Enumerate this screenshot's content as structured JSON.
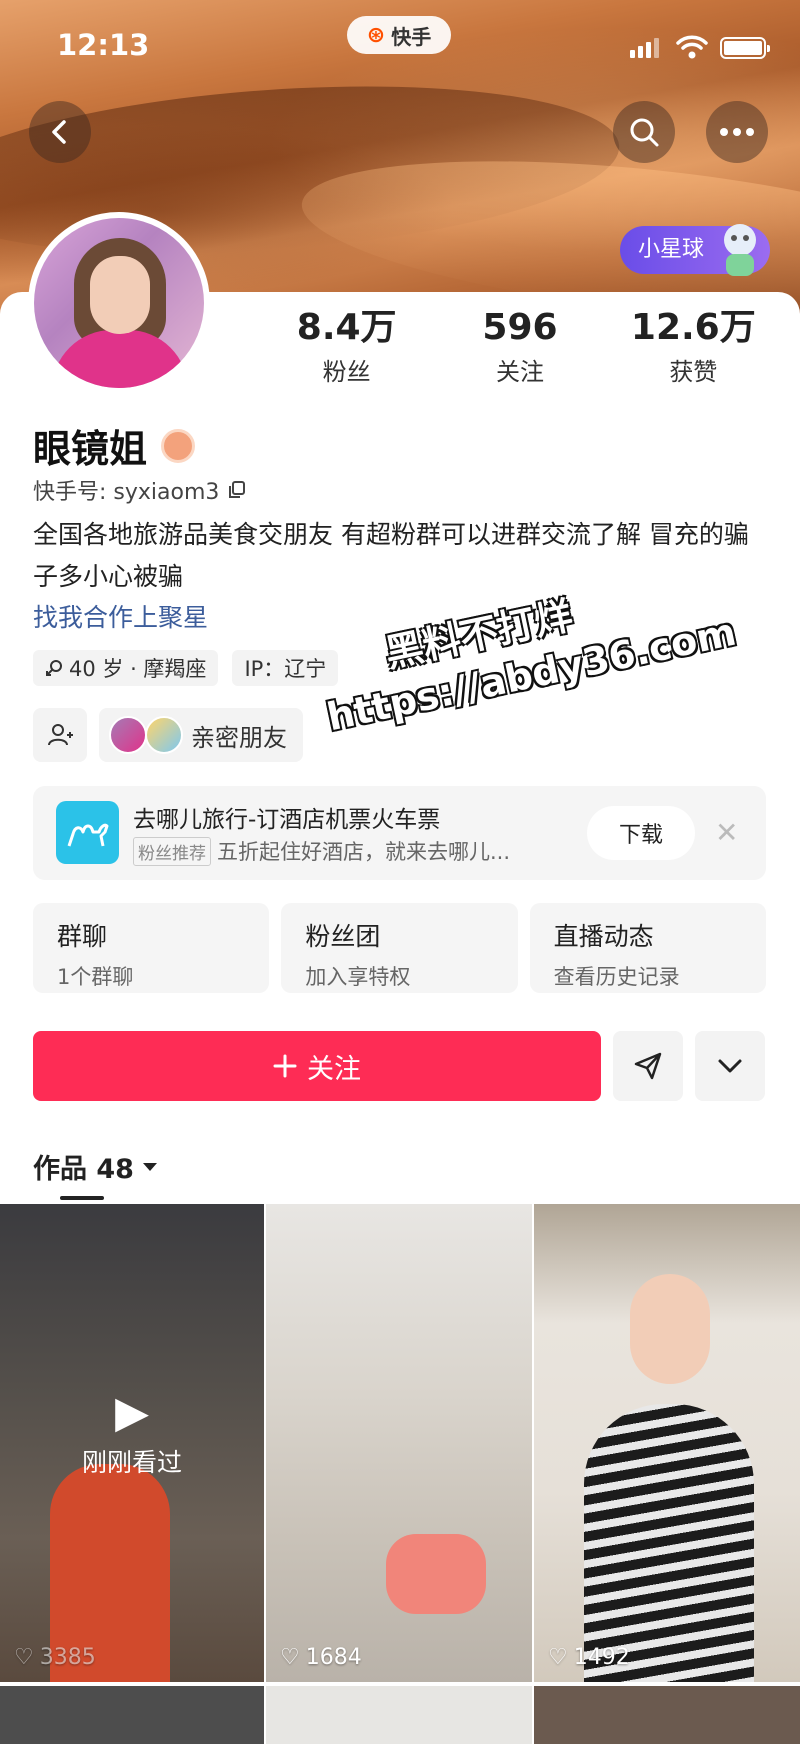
{
  "status_bar": {
    "time": "12:13",
    "app_name": "快手"
  },
  "nav": {
    "back": "back",
    "search": "search",
    "more": "more"
  },
  "planet_chip": {
    "label": "小星球"
  },
  "profile": {
    "name": "眼镜姐",
    "kuaishou_id_label": "快手号: syxiaom3",
    "bio": "全国各地旅游品美食交朋友 有超粉群可以进群交流了解 冒充的骗子多小心被骗",
    "coop_link": "找我合作上聚星",
    "tags": [
      {
        "label": "40 岁 · 摩羯座"
      },
      {
        "label": "IP：辽宁"
      }
    ],
    "close_friends_label": "亲密朋友"
  },
  "stats": [
    {
      "num": "8.4万",
      "label": "粉丝"
    },
    {
      "num": "596",
      "label": "关注"
    },
    {
      "num": "12.6万",
      "label": "获赞"
    }
  ],
  "ad": {
    "title": "去哪儿旅行-订酒店机票火车票",
    "chip": "粉丝推荐",
    "subtitle": "五折起住好酒店，就来去哪儿...",
    "download_label": "下载",
    "close_label": "✕"
  },
  "quick_links": [
    {
      "title": "群聊",
      "sub": "1个群聊"
    },
    {
      "title": "粉丝团",
      "sub": "加入享特权"
    },
    {
      "title": "直播动态",
      "sub": "查看历史记录"
    }
  ],
  "actions": {
    "follow_label": "关注"
  },
  "works": {
    "label": "作品 48"
  },
  "videos": [
    {
      "likes": "3385",
      "watched_label": "刚刚看过"
    },
    {
      "likes": "1684"
    },
    {
      "likes": "1492"
    }
  ],
  "watermark": {
    "line1": "黑料不打烊",
    "line2": "https://abdy36.com"
  },
  "colors": {
    "accent": "#fe2c55",
    "link": "#3c5d9b",
    "planet": "#6a4de8"
  }
}
